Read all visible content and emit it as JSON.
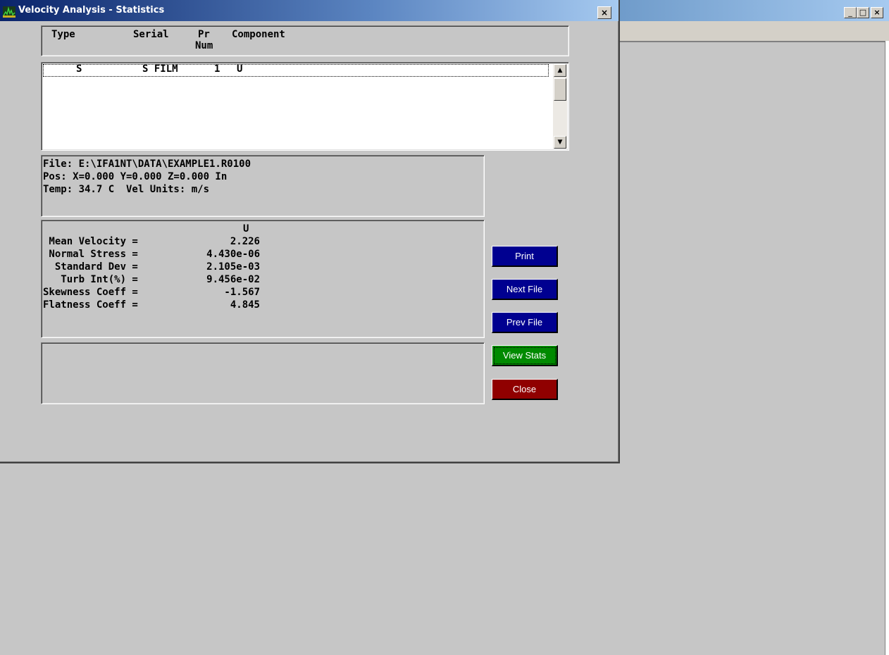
{
  "dialog": {
    "title": "Velocity Analysis - Statistics"
  },
  "table_header": {
    "type": "Type",
    "serial": "Serial",
    "pr": "Pr",
    "num": "Num",
    "component": "Component"
  },
  "list_rows": [
    {
      "type": "S",
      "serial": "S FILM",
      "pr_num": "1",
      "component": "U"
    }
  ],
  "file_info": {
    "file": "File: E:\\IFA1NT\\DATA\\EXAMPLE1.R0100",
    "pos": "Pos: X=0.000 Y=0.000 Z=0.000 In",
    "temp": "Temp: 34.7 C  Vel Units: m/s"
  },
  "stats": {
    "column_header": "U",
    "rows": [
      {
        "label": " Mean Velocity =",
        "value": "2.226"
      },
      {
        "label": " Normal Stress =",
        "value": "4.430e-06"
      },
      {
        "label": "  Standard Dev =",
        "value": "2.105e-03"
      },
      {
        "label": "   Turb Int(%) =",
        "value": "9.456e-02"
      },
      {
        "label": "Skewness Coeff =",
        "value": "-1.567"
      },
      {
        "label": "Flatness Coeff =",
        "value": "4.845"
      }
    ]
  },
  "buttons": {
    "print": "Print",
    "next_file": "Next File",
    "prev_file": "Prev File",
    "view_stats": "View Stats",
    "close": "Close"
  },
  "colors": {
    "button_blue": "#000090",
    "button_green": "#008a00",
    "button_red": "#900000",
    "title_bar": "#0a246a"
  },
  "icons": {
    "app_icon": "app-logo-icon",
    "minimize": "_",
    "maximize": "□",
    "close": "×",
    "scroll_up": "▲",
    "scroll_down": "▼"
  }
}
